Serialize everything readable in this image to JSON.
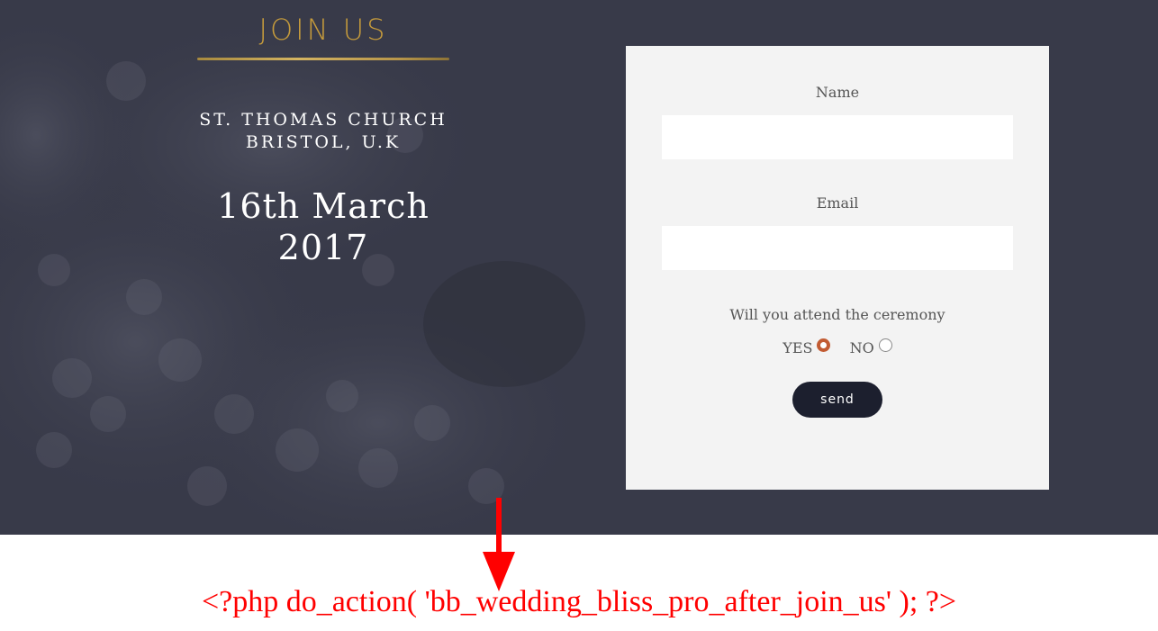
{
  "hero": {
    "title": "JOIN US",
    "venue_line1": "ST. THOMAS CHURCH",
    "venue_line2": "BRISTOL, U.K",
    "date_line1": "16th March",
    "date_line2": "2017"
  },
  "form": {
    "name_label": "Name",
    "name_value": "",
    "email_label": "Email",
    "email_value": "",
    "attend_question": "Will you attend the ceremony",
    "yes_label": "YES",
    "no_label": "NO",
    "selected": "YES",
    "send_label": "send"
  },
  "annotation": {
    "code_text": "<?php do_action( 'bb_wedding_bliss_pro_after_join_us' ); ?>",
    "arrow_color": "#ff0000"
  },
  "colors": {
    "hero_bg": "#383a49",
    "accent_gold": "#c49a3c",
    "card_bg": "#f3f3f3",
    "button_bg": "#1c1f2e",
    "radio_checked": "#c25b32"
  }
}
